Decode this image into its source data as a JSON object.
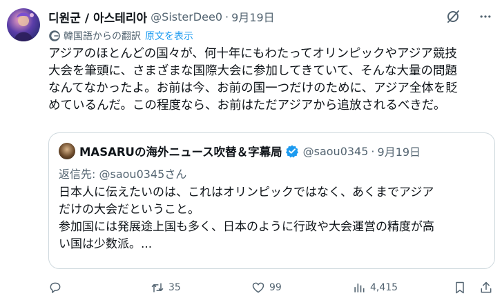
{
  "tweet": {
    "display_name": "디원군 / 아스테리아",
    "handle": "@SisterDee0",
    "separator": "·",
    "date": "9月19日",
    "translation_label": "韓国語からの翻訳",
    "show_original": "原文を表示",
    "text_lines": [
      "アジアのほとんどの国々が、何十年にもわたってオリンピックやアジア競技",
      "大会を筆頭に、さまざまな国際大会に参加してきていて、そんな大量の問題",
      "なんてなかったよ。お前は今、お前の国一つだけのために、アジア全体を貶",
      "めているんだ。この程度なら、お前はただアジアから追放されるべきだ。"
    ]
  },
  "quote": {
    "display_name": "MASARUの海外ニュース吹替＆字幕局",
    "handle": "@saou0345",
    "separator": "·",
    "date": "9月19日",
    "reply_prefix": "返信先:",
    "reply_handle": "@saou0345さん",
    "text_lines": [
      "日本人に伝えたいのは、これはオリンピックではなく、あくまでアジア",
      "だけの大会だということ。",
      "参加国には発展途上国も多く、日本のように行政や大会運営の精度が高",
      "い国は少数派。..."
    ]
  },
  "actions": {
    "reply_count": "",
    "retweet_count": "35",
    "like_count": "99",
    "views_count": "4,415"
  },
  "icons": {
    "header": "grok-icon",
    "more": "more-icon",
    "translate": "translate-icon",
    "verified": "verified-badge-icon",
    "reply": "reply-icon",
    "retweet": "retweet-icon",
    "like": "heart-icon",
    "views": "views-icon",
    "bookmark": "bookmark-icon",
    "share": "share-icon"
  },
  "colors": {
    "text": "#0f1419",
    "secondary": "#536471",
    "link": "#1d9bf0",
    "border": "#cfd9de",
    "verified": "#1d9bf0"
  }
}
